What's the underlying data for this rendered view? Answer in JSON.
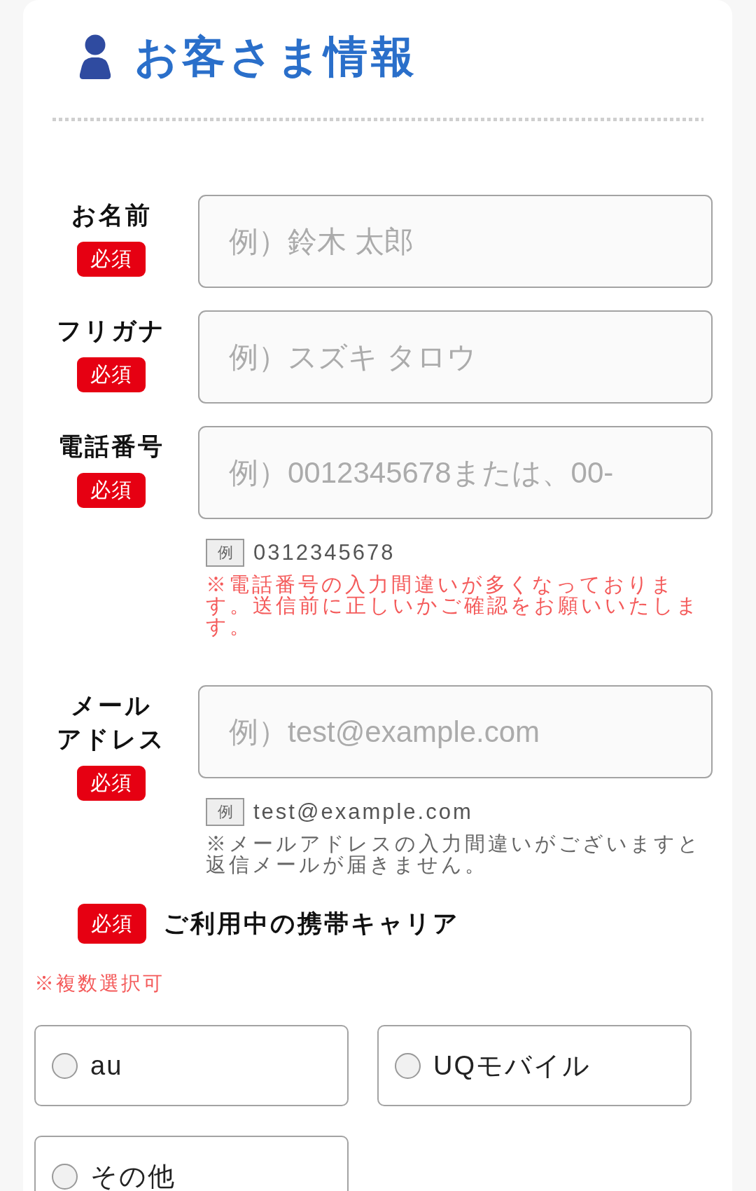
{
  "section": {
    "title": "お客さま情報"
  },
  "fields": [
    {
      "label": [
        "お名前"
      ],
      "badge": "必須",
      "placeholder": "例）鈴木 太郎"
    },
    {
      "label": [
        "フリガナ"
      ],
      "badge": "必須",
      "placeholder": "例）スズキ タロウ"
    },
    {
      "label": [
        "電話番号"
      ],
      "badge": "必須",
      "placeholder": "例）0012345678または、00-",
      "example": {
        "tag": "例",
        "text": "0312345678"
      },
      "note": {
        "kind": "warning",
        "text": "※電話番号の入力間違いが多くなっております。送信前に正しいかご確認をお願いいたします。"
      }
    },
    {
      "label": [
        "メール",
        "アドレス"
      ],
      "badge": "必須",
      "placeholder": "例）test@example.com",
      "example": {
        "tag": "例",
        "text": "test@example.com"
      },
      "note": {
        "kind": "info",
        "text": "※メールアドレスの入力間違いがございますと返信メールが届きません。"
      }
    }
  ],
  "carrier": {
    "badge": "必須",
    "title": "ご利用中の携帯キャリア",
    "note": "※複数選択可",
    "options": [
      {
        "label": "au",
        "checked": false
      },
      {
        "label": "UQモバイル",
        "checked": false
      },
      {
        "label": "その他",
        "checked": false
      }
    ]
  }
}
